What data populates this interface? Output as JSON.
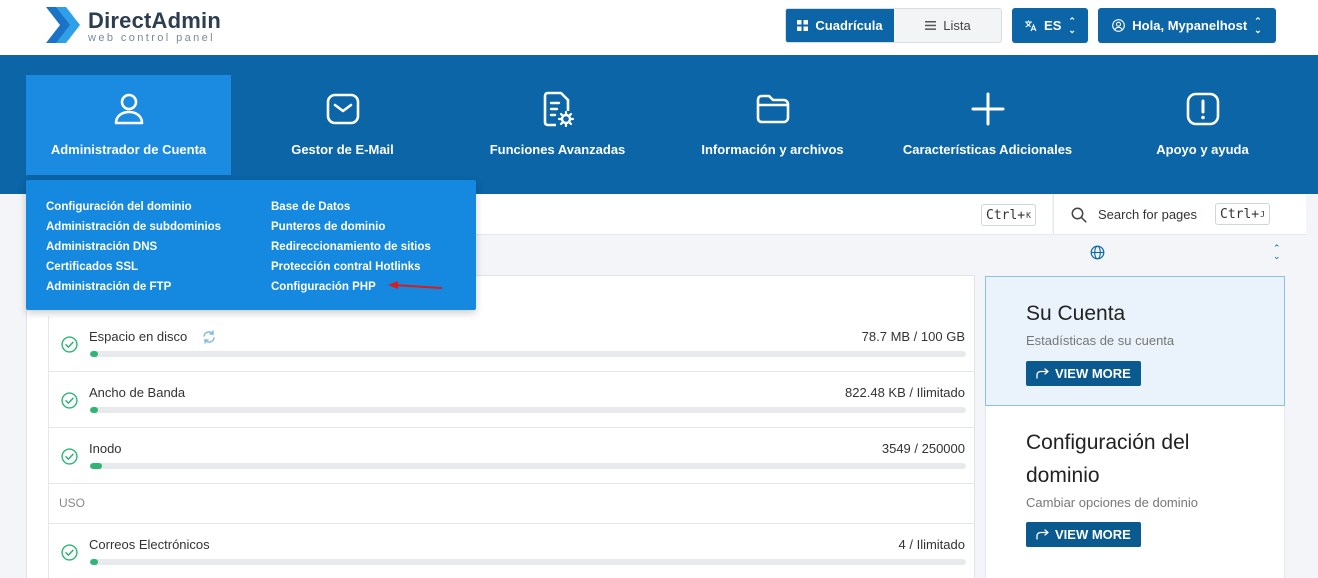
{
  "header": {
    "logo_title": "DirectAdmin",
    "logo_subtitle": "web control panel",
    "view_grid_label": "Cuadrícula",
    "view_list_label": "Lista",
    "language": "ES",
    "user_greeting": "Hola, Mypanelhost"
  },
  "nav": {
    "items": [
      {
        "label": "Administrador de Cuenta",
        "icon": "user-icon"
      },
      {
        "label": "Gestor de E-Mail",
        "icon": "mail-icon"
      },
      {
        "label": "Funciones Avanzadas",
        "icon": "file-gear-icon"
      },
      {
        "label": "Información y archivos",
        "icon": "folder-icon"
      },
      {
        "label": "Características Adicionales",
        "icon": "plus-icon"
      },
      {
        "label": "Apoyo y ayuda",
        "icon": "alert-icon"
      }
    ]
  },
  "dropdown": {
    "left": [
      "Configuración del dominio",
      "Administración de subdominios",
      "Administración DNS",
      "Certificados SSL",
      "Administración de FTP"
    ],
    "right": [
      "Base de Datos",
      "Punteros de dominio",
      "Redireccionamiento de sitios",
      "Protección contral Hotlinks",
      "Configuración PHP"
    ]
  },
  "search": {
    "shortcut_main": "Ctrl+",
    "shortcut_main_key": "K",
    "pages_label": "Search for pages",
    "shortcut_pages": "Ctrl+",
    "shortcut_pages_key": "J"
  },
  "stats": {
    "rows": [
      {
        "label": "Espacio en disco",
        "value": "78.7 MB / 100 GB",
        "percent": 0.08
      },
      {
        "label": "Ancho de Banda",
        "value": "822.48 KB / Ilimitado",
        "percent": 0
      },
      {
        "label": "Inodo",
        "value": "3549 / 250000",
        "percent": 1.4
      }
    ],
    "section_label": "USO",
    "usage_rows": [
      {
        "label": "Correos Electrónicos",
        "value": "4 / Ilimitado",
        "percent": 0
      }
    ]
  },
  "cards": [
    {
      "title": "Su Cuenta",
      "subtitle": "Estadísticas de su cuenta",
      "button": "VIEW MORE"
    },
    {
      "title_line1": "Configuración del",
      "title_line2": "dominio",
      "subtitle": "Cambiar opciones de dominio",
      "button": "VIEW MORE"
    }
  ],
  "colors": {
    "primary": "#0b65a6",
    "active_nav": "#1a8be0",
    "dropdown": "#1588df",
    "progress": "#2fb574"
  }
}
